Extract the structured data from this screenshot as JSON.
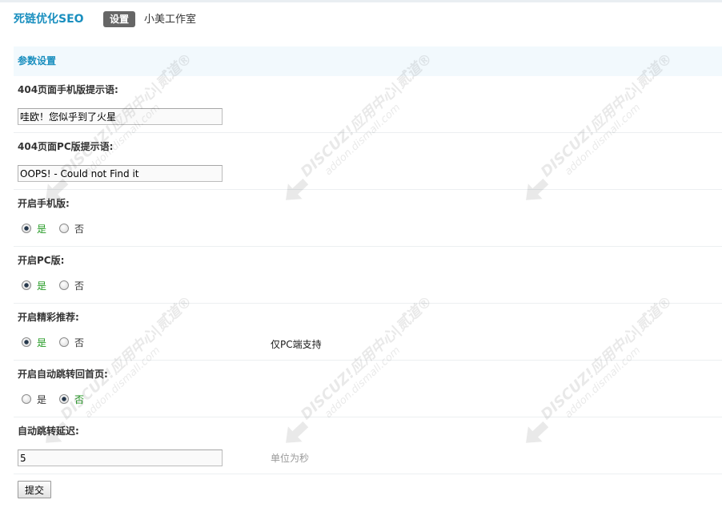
{
  "header": {
    "title": "死链优化SEO",
    "active_tab": "设置",
    "author": "小美工作室"
  },
  "section": {
    "title": "参数设置"
  },
  "settings": [
    {
      "label": "404页面手机版提示语:",
      "value": "哇欧！您似乎到了火星"
    },
    {
      "label": "404页面PC版提示语:",
      "value": "OOPS! - Could not Find it"
    },
    {
      "label": "开启手机版:",
      "options": [
        "是",
        "否"
      ],
      "selected": "是"
    },
    {
      "label": "开启PC版:",
      "options": [
        "是",
        "否"
      ],
      "selected": "是"
    },
    {
      "label": "开启精彩推荐:",
      "options": [
        "是",
        "否"
      ],
      "selected": "是",
      "comment": "仅PC端支持"
    },
    {
      "label": "开启自动跳转回首页:",
      "options": [
        "是",
        "否"
      ],
      "selected": "否"
    },
    {
      "label": "自动跳转延迟:",
      "value": "5",
      "comment": "单位为秒"
    }
  ],
  "submit_label": "提交",
  "watermark": {
    "line1": "DISCUZ!应用中心|贰道®",
    "line2": "addon.dismall.com"
  },
  "colors": {
    "accent": "#1a8fbf",
    "section_bg": "#f2f9fd",
    "tab_bg": "#666666",
    "checked_label": "#229922"
  }
}
